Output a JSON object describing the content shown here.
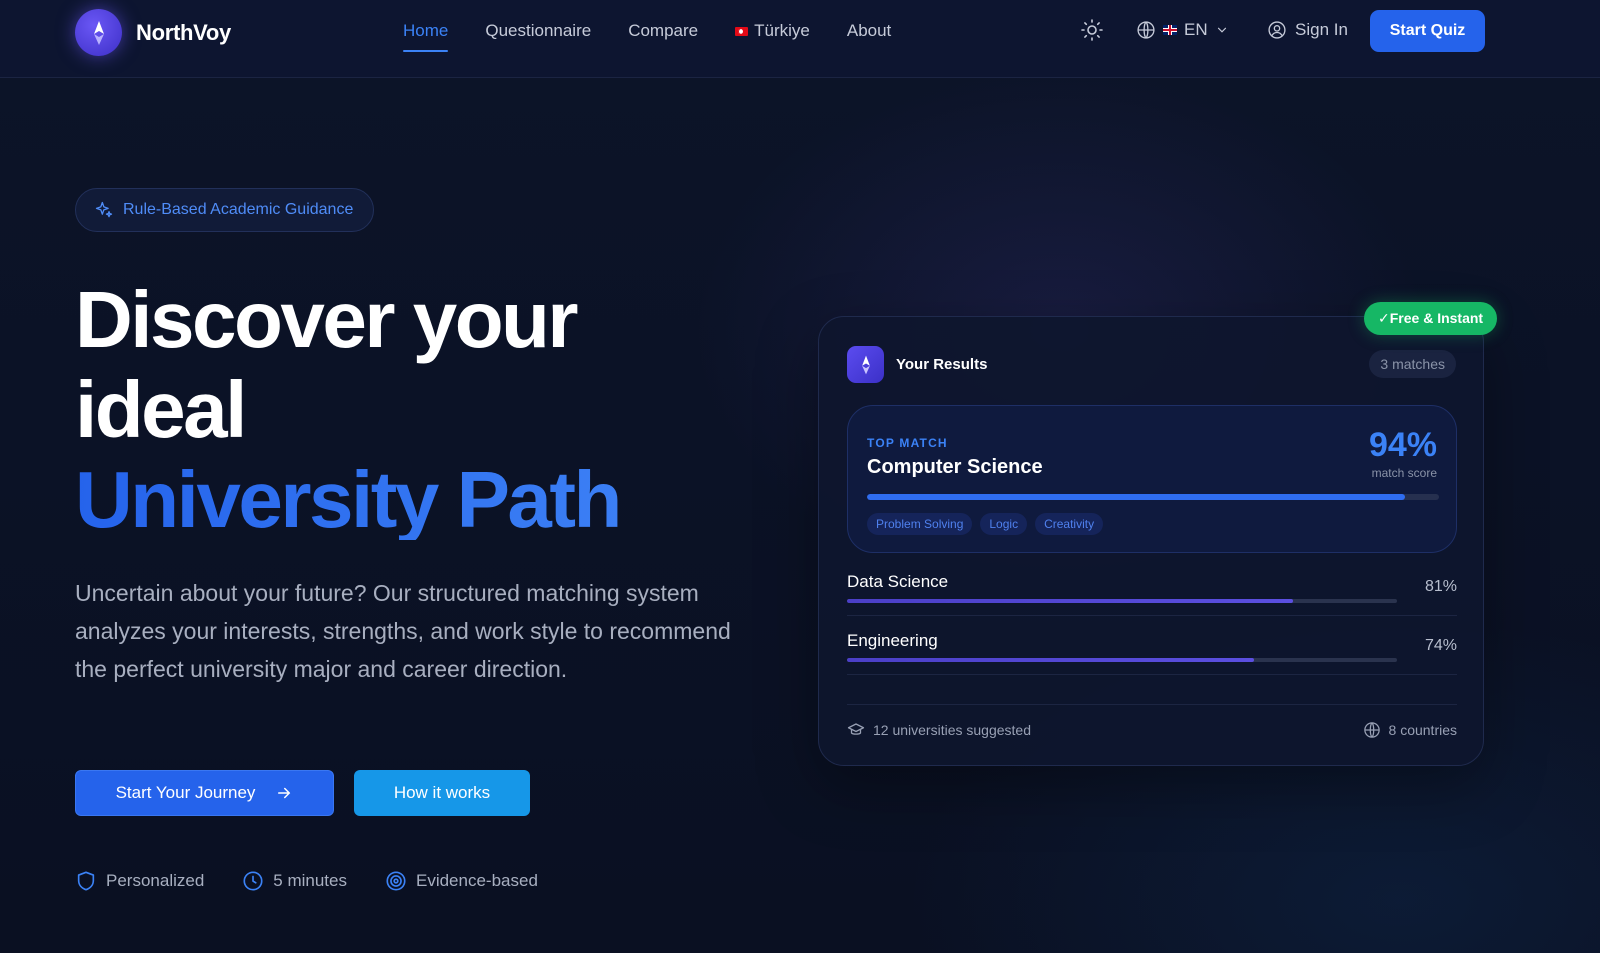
{
  "brand": {
    "name": "NorthVoy"
  },
  "nav": {
    "links": [
      "Home",
      "Questionnaire",
      "Compare",
      "Türkiye",
      "About"
    ],
    "active": "Home",
    "language": "EN",
    "sign_in": "Sign In",
    "cta": "Start Quiz"
  },
  "hero": {
    "pill": "Rule-Based Academic Guidance",
    "title_line1": "Discover your",
    "title_line2": "ideal",
    "title_line3": "University Path",
    "description": "Uncertain about your future? Our structured matching system analyzes your interests, strengths, and work style to recommend the perfect university major and career direction.",
    "primary_button": "Start Your Journey",
    "secondary_button": "How it works",
    "features": [
      "Personalized",
      "5 minutes",
      "Evidence-based"
    ]
  },
  "results_card": {
    "badge": "✓Free & Instant",
    "title": "Your Results",
    "matches": "3 matches",
    "top_match": {
      "label": "TOP MATCH",
      "name": "Computer Science",
      "score": "94%",
      "score_value": 0.94,
      "score_label": "match score",
      "tags": [
        "Problem Solving",
        "Logic",
        "Creativity"
      ]
    },
    "others": [
      {
        "name": "Data Science",
        "pct": "81%",
        "value": 0.81
      },
      {
        "name": "Engineering",
        "pct": "74%",
        "value": 0.74
      }
    ],
    "footer_left": "12 universities suggested",
    "footer_right": "8 countries"
  },
  "colors": {
    "accent": "#2563eb",
    "success": "#16b765",
    "background": "#0b1124"
  }
}
